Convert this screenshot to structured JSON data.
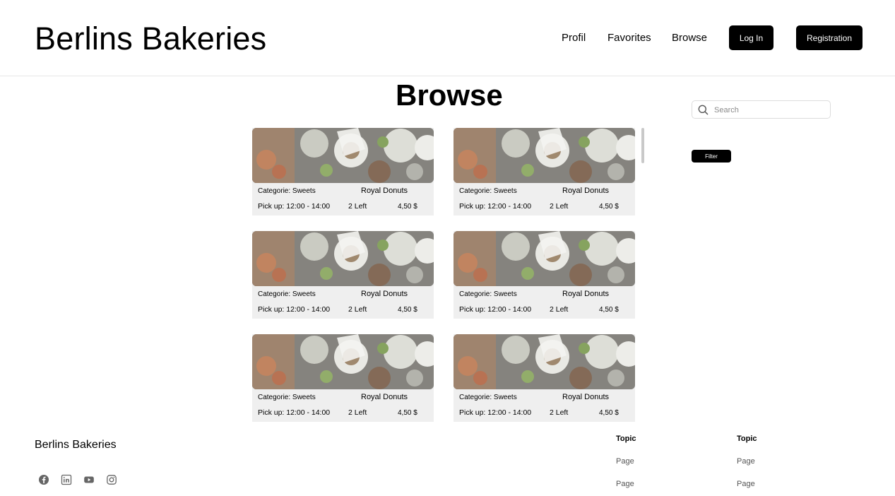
{
  "header": {
    "brand": "Berlins Bakeries",
    "nav": [
      "Profil",
      "Favorites",
      "Browse"
    ],
    "login_label": "Log In",
    "register_label": "Registration"
  },
  "page_title": "Browse",
  "search": {
    "placeholder": "Search"
  },
  "filter_label": "Filter",
  "cards": [
    {
      "category": "Categorie: Sweets",
      "name": "Royal Donuts",
      "pickup": "Pick up: 12:00 - 14:00",
      "left": "2 Left",
      "price": "4,50 $"
    },
    {
      "category": "Categorie: Sweets",
      "name": "Royal Donuts",
      "pickup": "Pick up: 12:00 - 14:00",
      "left": "2 Left",
      "price": "4,50 $"
    },
    {
      "category": "Categorie: Sweets",
      "name": "Royal Donuts",
      "pickup": "Pick up: 12:00 - 14:00",
      "left": "2 Left",
      "price": "4,50 $"
    },
    {
      "category": "Categorie: Sweets",
      "name": "Royal Donuts",
      "pickup": "Pick up: 12:00 - 14:00",
      "left": "2 Left",
      "price": "4,50 $"
    },
    {
      "category": "Categorie: Sweets",
      "name": "Royal Donuts",
      "pickup": "Pick up: 12:00 - 14:00",
      "left": "2 Left",
      "price": "4,50 $"
    },
    {
      "category": "Categorie: Sweets",
      "name": "Royal Donuts",
      "pickup": "Pick up: 12:00 - 14:00",
      "left": "2 Left",
      "price": "4,50 $"
    }
  ],
  "footer": {
    "brand": "Berlins Bakeries",
    "social_icons": [
      "facebook-icon",
      "linkedin-icon",
      "youtube-icon",
      "instagram-icon"
    ],
    "columns": [
      {
        "topic": "Topic",
        "pages": [
          "Page",
          "Page"
        ]
      },
      {
        "topic": "Topic",
        "pages": [
          "Page",
          "Page"
        ]
      }
    ]
  }
}
